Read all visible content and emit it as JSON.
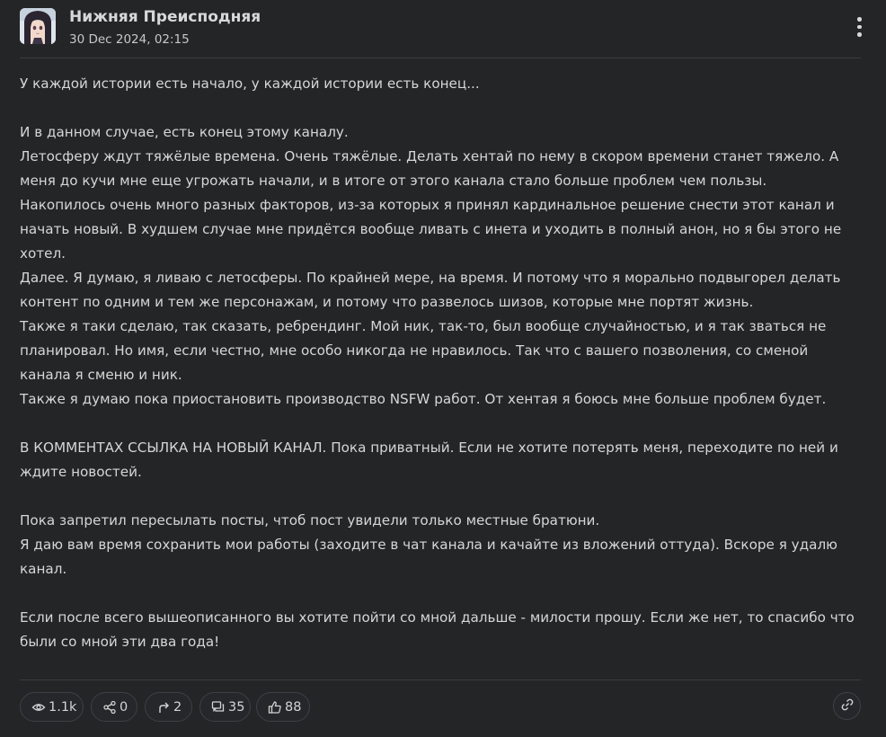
{
  "post": {
    "channel_name": "Нижняя Преисподняя",
    "date": "30 Dec 2024, 02:15",
    "avatar_icon": "anime-girl-avatar",
    "more_icon": "vertical-dots-icon",
    "paragraphs": [
      "У каждой истории есть начало, у каждой истории есть конец...",
      "",
      "И в данном случае, есть конец этому каналу.",
      "Летосферу ждут тяжёлые времена. Очень тяжёлые. Делать хентай по нему в скором времени станет тяжело. А меня до кучи мне еще угрожать начали, и в итоге от этого канала стало больше проблем чем пользы.",
      "Накопилось очень много разных факторов, из-за которых я принял кардинальное решение снести этот канал и начать новый. В худшем случае мне придётся вообще ливать с инета и уходить в полный анон, но я бы этого не хотел.",
      "Далее. Я думаю, я ливаю с летосферы. По крайней мере, на время. И потому что я морально подвыгорел делать контент по одним и тем же персонажам, и потому что развелось шизов, которые мне портят жизнь.",
      "Также я таки сделаю, так сказать, ребрендинг. Мой ник, так-то, был вообще случайностью, и я так зваться не планировал. Но имя, если честно, мне особо никогда не нравилось. Так что с вашего позволения, со сменой канала я сменю и ник.",
      "Также я думаю пока приостановить производство NSFW работ. От хентая я боюсь мне больше проблем будет.",
      "",
      "В КОММЕНТАХ ССЫЛКА НА НОВЫЙ КАНАЛ. Пока приватный. Если не хотите потерять меня, переходите по ней и ждите новостей.",
      "",
      "Пока запретил пересылать посты, чтоб пост увидели только местные братюни.",
      "Я даю вам время сохранить мои работы (заходите в чат канала и качайте из вложений оттуда). Вскоре я удалю канал.",
      "",
      "Если после всего вышеописанного вы хотите пойти со мной дальше - милости прошу. Если же нет, то спасибо что были со мной эти два года!"
    ]
  },
  "stats": {
    "views": "1.1k",
    "shares": "0",
    "forwards": "2",
    "comments": "35",
    "likes": "88",
    "icons": {
      "views": "eye-icon",
      "shares": "share-icon",
      "forwards": "forward-arrow-icon",
      "comments": "comments-icon",
      "likes": "thumbs-up-icon",
      "link": "link-icon"
    }
  },
  "colors": {
    "background": "#242526",
    "text": "#d6d6d6",
    "border": "#3e4044"
  }
}
